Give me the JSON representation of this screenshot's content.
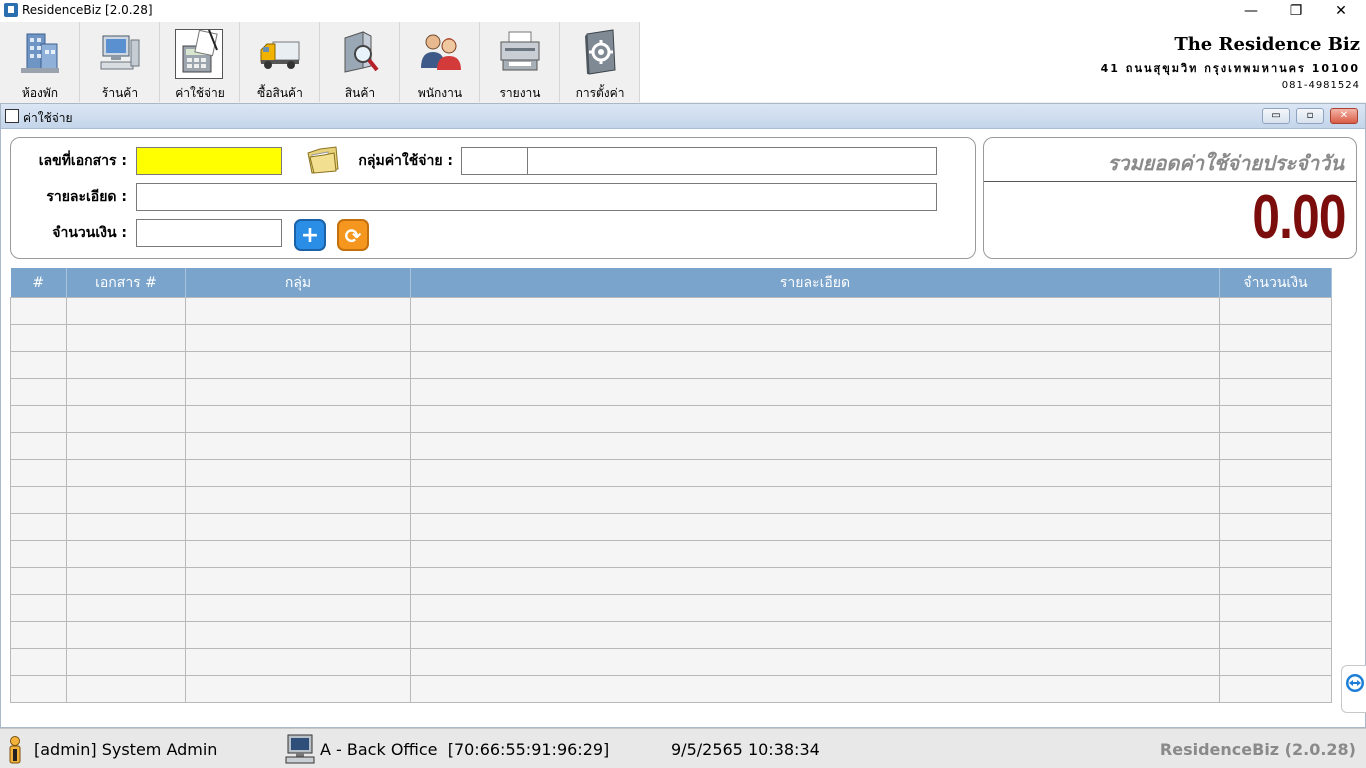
{
  "window": {
    "title": "ResidenceBiz [2.0.28]",
    "minimize": "—",
    "restore": "❐",
    "close": "✕"
  },
  "toolbar": {
    "items": [
      {
        "label": "ห้องพัก",
        "icon": "building-icon"
      },
      {
        "label": "ร้านค้า",
        "icon": "computer-icon"
      },
      {
        "label": "ค่าใช้จ่าย",
        "icon": "calculator-icon"
      },
      {
        "label": "ซื้อสินค้า",
        "icon": "truck-icon"
      },
      {
        "label": "สินค้า",
        "icon": "product-search-icon"
      },
      {
        "label": "พนักงาน",
        "icon": "staff-icon"
      },
      {
        "label": "รายงาน",
        "icon": "printer-icon"
      },
      {
        "label": "การตั้งค่า",
        "icon": "settings-book-icon"
      }
    ]
  },
  "company": {
    "name": "The Residence Biz",
    "address": "41 ถนนสุขุมวิท กรุงเทพมหานคร 10100",
    "phone": "081-4981524"
  },
  "form_window": {
    "title": "ค่าใช้จ่าย",
    "min": "▭",
    "restore": "▫",
    "close": "✕"
  },
  "form": {
    "doc_no_label": "เลขที่เอกสาร :",
    "doc_no_value": "",
    "group_label": "กลุ่มค่าใช้จ่าย :",
    "group_code": "",
    "group_name": "",
    "detail_label": "รายละเอียด :",
    "detail_value": "",
    "amount_label": "จำนวนเงิน :",
    "amount_value": "",
    "add_symbol": "+",
    "refresh_symbol": "⟳"
  },
  "summary": {
    "title": "รวมยอดค่าใช้จ่ายประจำวัน",
    "value": "0.00"
  },
  "table": {
    "columns": [
      "#",
      "เอกสาร #",
      "กลุ่ม",
      "รายละเอียด",
      "จำนวนเงิน"
    ],
    "rows": []
  },
  "status": {
    "user": "[admin] System Admin",
    "station": "A - Back Office  [70:66:55:91:96:29]",
    "datetime": "9/5/2565 10:38:34",
    "app": "ResidenceBiz (2.0.28)"
  },
  "colors": {
    "header": "#7aa4cc",
    "doc_no_highlight": "#ffff00",
    "summary_value": "#7b0d0d",
    "add_button": "#2a8ee6",
    "refresh_button": "#f5961e"
  }
}
